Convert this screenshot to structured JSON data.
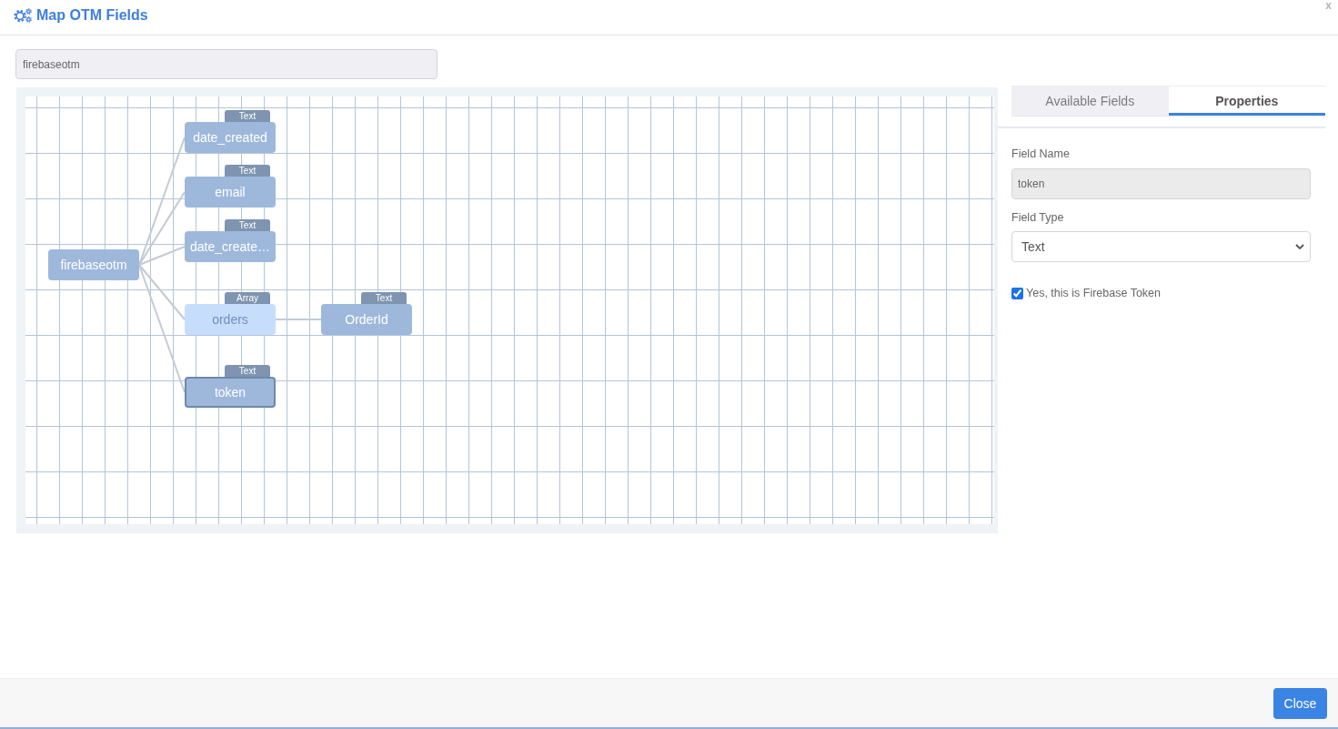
{
  "dialog": {
    "title": "Map OTM Fields",
    "close_label": "x"
  },
  "search": {
    "value": "firebaseotm",
    "disabled": true
  },
  "diagram": {
    "root": {
      "label": "firebaseotm",
      "selected": false,
      "children": [
        {
          "label": "date_created",
          "tag": "Text",
          "kind": "field",
          "selected": false
        },
        {
          "label": "email",
          "tag": "Text",
          "kind": "field",
          "selected": false
        },
        {
          "label": "date_create…",
          "tag": "Text",
          "kind": "field",
          "selected": false
        },
        {
          "label": "orders",
          "tag": "Array",
          "kind": "array",
          "selected": false,
          "children": [
            {
              "label": "OrderId",
              "tag": "Text",
              "selected": false
            }
          ]
        },
        {
          "label": "token",
          "tag": "Text",
          "kind": "field",
          "selected": true
        }
      ]
    }
  },
  "panel": {
    "tabs": [
      {
        "label": "Available Fields",
        "selected": false
      },
      {
        "label": "Properties",
        "selected": true
      }
    ],
    "field_name": {
      "label": "Field Name",
      "value": "token",
      "disabled": true
    },
    "field_type": {
      "label": "Field Type",
      "value": "Text"
    },
    "firebase_token": {
      "label": "Yes, this is Firebase Token",
      "checked": true
    }
  },
  "footer": {
    "buttons": [
      "Close"
    ]
  }
}
